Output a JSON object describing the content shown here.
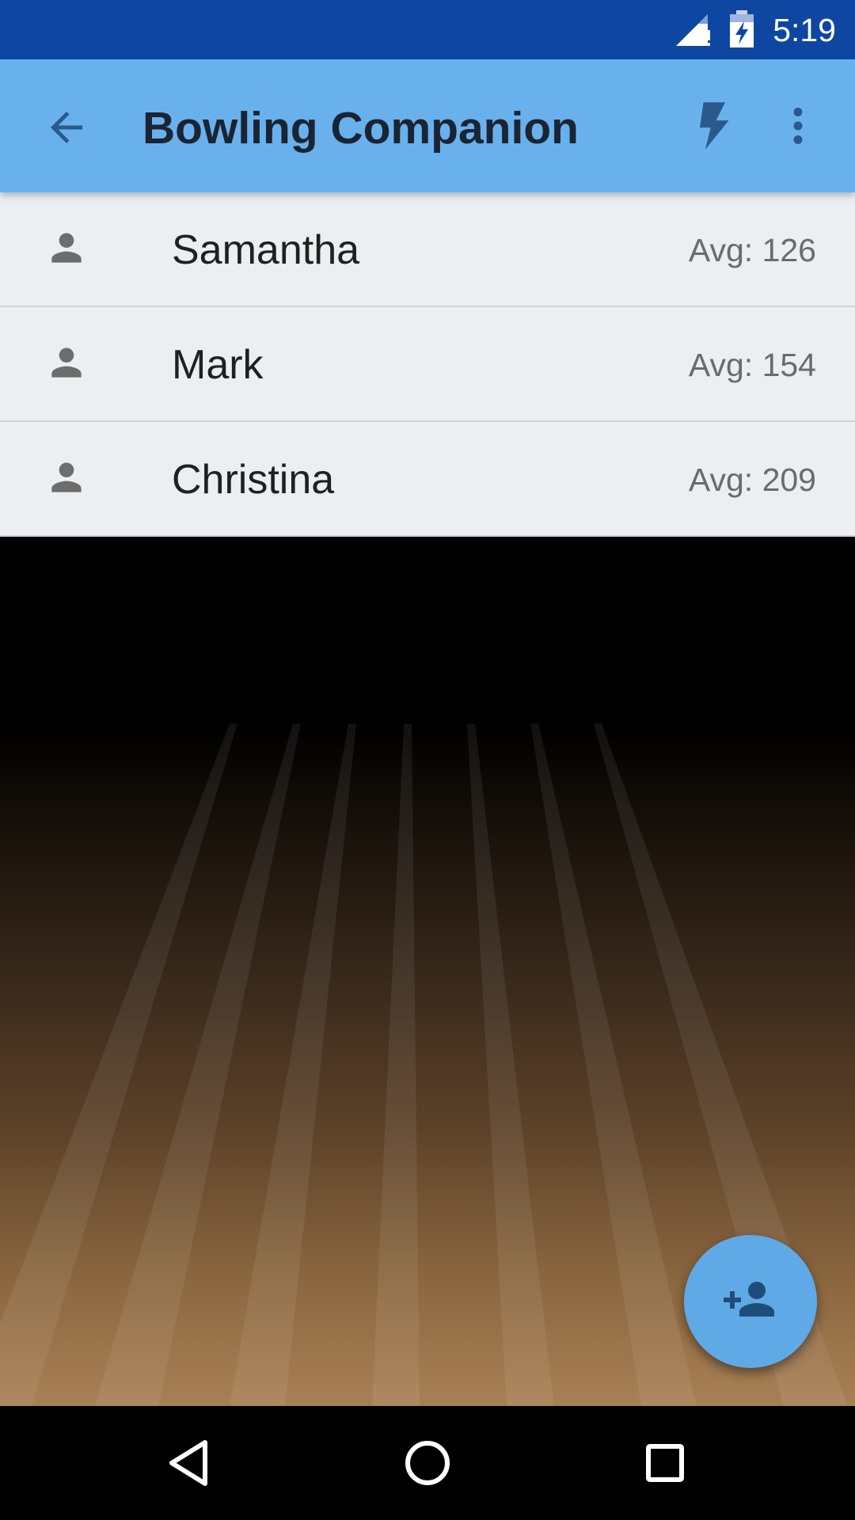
{
  "status_bar": {
    "time": "5:19",
    "icons": [
      "signal-icon",
      "battery-charging-icon"
    ],
    "background_color": "#0d47a1"
  },
  "app_bar": {
    "title": "Bowling Companion",
    "icons": [
      "back-arrow-icon",
      "bolt-icon",
      "more-vert-icon"
    ],
    "background_color": "#69b1ec"
  },
  "bowlers": [
    {
      "name": "Samantha",
      "average": "Avg: 126",
      "icon": "person-icon"
    },
    {
      "name": "Mark",
      "average": "Avg: 154",
      "icon": "person-icon"
    },
    {
      "name": "Christina",
      "average": "Avg: 209",
      "icon": "person-icon"
    }
  ],
  "fab": {
    "icon": "add-person-icon",
    "color": "#5fa9e6"
  },
  "nav_bar": {
    "icons": [
      "nav-back-icon",
      "nav-home-icon",
      "nav-recents-icon"
    ]
  }
}
